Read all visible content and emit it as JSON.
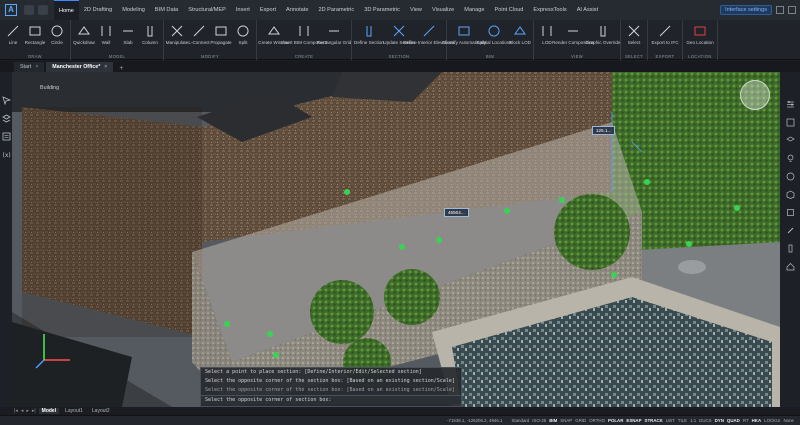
{
  "ribbon_tabs": [
    "Home",
    "2D Drafting",
    "Modeling",
    "BIM Data",
    "Structural/MEP",
    "Insert",
    "Export",
    "Annotate",
    "2D Parametric",
    "3D Parametric",
    "View",
    "Visualize",
    "Manage",
    "Point Cloud",
    "ExpressTools",
    "AI Assist"
  ],
  "active_ribbon_tab": "Home",
  "interface_settings_label": "Interface settings",
  "ribbon_groups": [
    {
      "name": "DRAW",
      "tools": [
        "Line",
        "Rectangle",
        "Circle"
      ]
    },
    {
      "name": "MODEL",
      "tools": [
        "Quickdraw",
        "Wall",
        "Slab",
        "Column"
      ]
    },
    {
      "name": "MODIFY",
      "tools": [
        "Manipulate",
        "L-Connect",
        "Propagate",
        "Split"
      ]
    },
    {
      "name": "CREATE",
      "tools": [
        "Create Window",
        "Insert BIM Component",
        "Rectangular Grid"
      ]
    },
    {
      "name": "SECTION",
      "tools": [
        "Define Section",
        "Update Section",
        "Define Interior Elevations"
      ]
    },
    {
      "name": "BIM",
      "tools": [
        "Classify Automatically",
        "Spatial Locations",
        "Block LOD"
      ]
    },
    {
      "name": "VIEW",
      "tools": [
        "LOD",
        "Render Composition",
        "Graphic Override"
      ]
    },
    {
      "name": "SELECT",
      "tools": [
        "Select"
      ]
    },
    {
      "name": "EXPORT",
      "tools": [
        "Export to IFC"
      ]
    },
    {
      "name": "LOCATION",
      "tools": [
        "Geo Location"
      ]
    }
  ],
  "document_tabs": [
    {
      "label": "Start",
      "active": false
    },
    {
      "label": "Manchester Office*",
      "active": true
    }
  ],
  "viewport_label": "Building",
  "point_tags": [
    "125.1...",
    "46504..."
  ],
  "command_history": [
    "Select a point to place section: [Define/Interior/Edit/Selected section]",
    "Select the opposite corner of the section box: [Based on an existing section/Scale]",
    "Select the opposite corner of section box:"
  ],
  "layout_tabs": [
    "Model",
    "Layout1",
    "Layout2"
  ],
  "active_layout": "Model",
  "status": {
    "coordinates": "-71538.1, -126206.2, 4946.1",
    "style": "Standard",
    "annotation_scale": "ISO-25",
    "toggles": [
      {
        "label": "BIM",
        "on": true
      },
      {
        "label": "SNAP",
        "on": false
      },
      {
        "label": "GRID",
        "on": false
      },
      {
        "label": "ORTHO",
        "on": false
      },
      {
        "label": "POLAR",
        "on": true
      },
      {
        "label": "ESNAP",
        "on": true
      },
      {
        "label": "STRACK",
        "on": true
      },
      {
        "label": "LWT",
        "on": false
      },
      {
        "label": "TILE",
        "on": false
      },
      {
        "label": "1:1",
        "on": false
      },
      {
        "label": "DUCS",
        "on": false
      },
      {
        "label": "DYN",
        "on": true
      },
      {
        "label": "QUAD",
        "on": true
      },
      {
        "label": "RT",
        "on": false
      },
      {
        "label": "HKA",
        "on": true
      },
      {
        "label": "LOCKUI",
        "on": false
      },
      {
        "label": "None",
        "on": false
      }
    ]
  },
  "colors": {
    "accent": "#3d8bff",
    "marker": "#39d353",
    "background": "#1b1e24"
  }
}
